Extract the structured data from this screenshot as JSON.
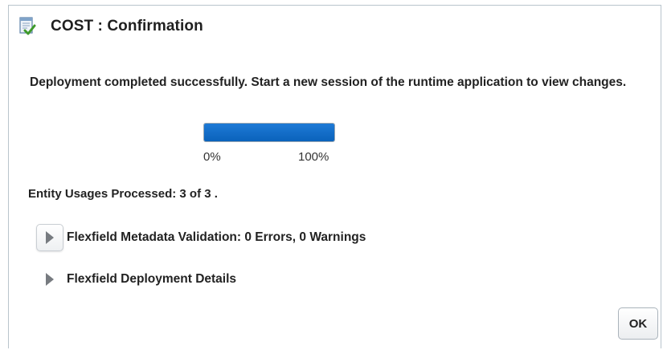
{
  "dialog": {
    "title": "COST : Confirmation",
    "title_icon": "document-check-icon"
  },
  "message": "Deployment completed successfully. Start a new session of the runtime application to view changes.",
  "progress": {
    "value_percent": 100,
    "min_label": "0%",
    "max_label": "100%",
    "fill_color": "#0b66c3"
  },
  "entity_usages": "Entity Usages Processed: 3 of 3 .",
  "sections": [
    {
      "label": "Flexfield Metadata Validation: 0 Errors, 0 Warnings",
      "icon": "expand-triangle-icon",
      "expanded": false
    },
    {
      "label": "Flexfield Deployment Details",
      "icon": "expand-triangle-icon",
      "expanded": false
    }
  ],
  "buttons": {
    "ok_label": "OK"
  }
}
